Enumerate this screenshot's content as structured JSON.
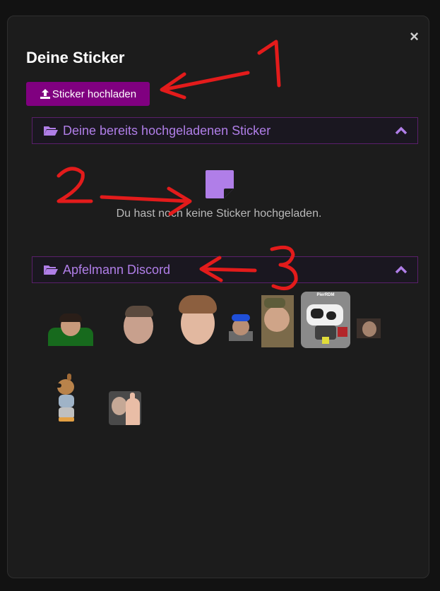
{
  "modal": {
    "title": "Deine Sticker",
    "close_label": "×",
    "upload_label": "Sticker hochladen"
  },
  "sections": {
    "uploaded": {
      "label": "Deine bereits hochgeladenen Sticker",
      "empty_text": "Du hast noch keine Sticker hochgeladen."
    },
    "discord": {
      "label": "Apfelmann Discord"
    }
  },
  "stickers": [
    {
      "name": "sticker-1"
    },
    {
      "name": "sticker-2"
    },
    {
      "name": "sticker-3"
    },
    {
      "name": "sticker-4"
    },
    {
      "name": "sticker-5"
    },
    {
      "name": "sticker-6",
      "caption": "PierRDM"
    },
    {
      "name": "sticker-7"
    },
    {
      "name": "sticker-8"
    },
    {
      "name": "sticker-9"
    }
  ],
  "annotations": [
    "1",
    "2",
    "3"
  ],
  "colors": {
    "accent": "#800080",
    "section_text": "#b07ee8",
    "section_border": "#5a1f6b",
    "annotation": "#e31b1b"
  }
}
